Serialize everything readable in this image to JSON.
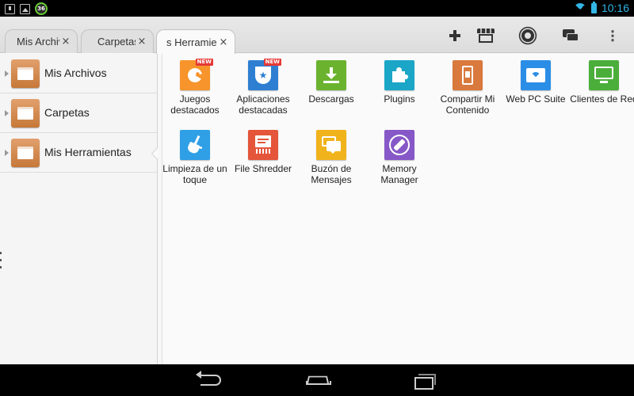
{
  "status_bar": {
    "notification_badge": "36",
    "time": "10:16",
    "icons": [
      "download-icon",
      "image-icon",
      "wifi-icon",
      "battery-icon"
    ]
  },
  "tabs": [
    {
      "label": "Mis Archivos",
      "close": "×",
      "active": false
    },
    {
      "label": "Carpetas",
      "close": "×",
      "active": false
    },
    {
      "label": "s Herramie",
      "close": "×",
      "active": true
    }
  ],
  "toolbar": {
    "icons": [
      "plus-icon",
      "store-icon",
      "gear-icon",
      "chat-icon",
      "more-icon"
    ]
  },
  "sidebar": {
    "items": [
      {
        "label": "Mis Archivos"
      },
      {
        "label": "Carpetas"
      },
      {
        "label": "Mis Herramientas"
      }
    ]
  },
  "tools": [
    {
      "name": "Juegos destacados",
      "badge": "NEW",
      "color": "#f7942b",
      "icon": "pacman-icon"
    },
    {
      "name": "Aplicaciones destacadas",
      "badge": "NEW",
      "color": "#2e7fd1",
      "icon": "star-shield-icon"
    },
    {
      "name": "Descargas",
      "color": "#6bb32f",
      "icon": "download-icon"
    },
    {
      "name": "Plugins",
      "color": "#1ba6c7",
      "icon": "puzzle-icon"
    },
    {
      "name": "Compartir Mi Contenido",
      "color": "#d9793d",
      "icon": "phone-share-icon"
    },
    {
      "name": "Web PC Suite",
      "color": "#2b8ee6",
      "icon": "wifi-folder-icon"
    },
    {
      "name": "Clientes de Red",
      "color": "#4cae3a",
      "icon": "monitor-icon"
    },
    {
      "name": "Limpieza de un toque",
      "color": "#2f9fe6",
      "icon": "broom-icon"
    },
    {
      "name": "File Shredder",
      "color": "#e4553a",
      "icon": "shredder-icon"
    },
    {
      "name": "Buzón de Mensajes",
      "color": "#f1b31c",
      "icon": "message-box-icon"
    },
    {
      "name": "Memory Manager",
      "color": "#8658c7",
      "icon": "memory-icon"
    }
  ],
  "colors": {
    "accent": "#33b5e5",
    "folder": "#d0854b"
  }
}
